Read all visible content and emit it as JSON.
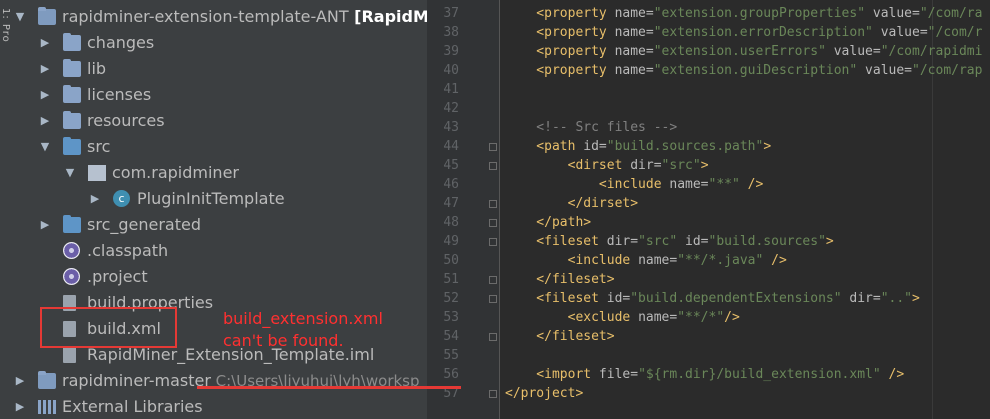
{
  "side_strip": {
    "text": "1: Pro"
  },
  "tree": [
    {
      "id": "root",
      "label": "rapidminer-extension-template-ANT",
      "suffix": "[RapidMi",
      "depth": 0,
      "arrow": "▼",
      "icon": "module-folder"
    },
    {
      "id": "changes",
      "label": "changes",
      "depth": 1,
      "arrow": "▶",
      "icon": "folder"
    },
    {
      "id": "lib",
      "label": "lib",
      "depth": 1,
      "arrow": "▶",
      "icon": "folder"
    },
    {
      "id": "licenses",
      "label": "licenses",
      "depth": 1,
      "arrow": "▶",
      "icon": "folder"
    },
    {
      "id": "resources",
      "label": "resources",
      "depth": 1,
      "arrow": "▶",
      "icon": "folder"
    },
    {
      "id": "src",
      "label": "src",
      "depth": 1,
      "arrow": "▼",
      "icon": "source-folder"
    },
    {
      "id": "com-rapidminer",
      "label": "com.rapidminer",
      "depth": 2,
      "arrow": "▼",
      "icon": "package"
    },
    {
      "id": "plugininittemplate",
      "label": "PluginInitTemplate",
      "depth": 3,
      "arrow": "▶",
      "icon": "class"
    },
    {
      "id": "src-generated",
      "label": "src_generated",
      "depth": 1,
      "arrow": "▶",
      "icon": "source-folder"
    },
    {
      "id": "classpath",
      "label": ".classpath",
      "depth": 1,
      "arrow": "",
      "icon": "eclipse-file"
    },
    {
      "id": "project",
      "label": ".project",
      "depth": 1,
      "arrow": "",
      "icon": "eclipse-file"
    },
    {
      "id": "build-properties",
      "label": "build.properties",
      "depth": 1,
      "arrow": "",
      "icon": "properties-file"
    },
    {
      "id": "build-xml",
      "label": "build.xml",
      "depth": 1,
      "arrow": "",
      "icon": "ant-file"
    },
    {
      "id": "iml",
      "label": "RapidMiner_Extension_Template.iml",
      "depth": 1,
      "arrow": "",
      "icon": "iml-file"
    },
    {
      "id": "rapidminer-master",
      "label": "rapidminer-master",
      "depth": 0,
      "arrow": "▶",
      "icon": "module-folder",
      "path": "C:\\Users\\liyuhui\\lyh\\worksp"
    },
    {
      "id": "external-libraries",
      "label": "External Libraries",
      "depth": 0,
      "arrow": "▶",
      "icon": "libraries"
    }
  ],
  "annotation": {
    "line1": "build_extension.xml",
    "line2": "can't be found.",
    "color": "#ff3030"
  },
  "editor": {
    "lines": [
      {
        "n": "37",
        "parts": [
          [
            "t",
            "    <property "
          ],
          [
            "a",
            "name="
          ],
          [
            "v",
            "\"extension.groupProperties\""
          ],
          [
            "a",
            " value="
          ],
          [
            "v",
            "\"/com/ra"
          ]
        ]
      },
      {
        "n": "38",
        "parts": [
          [
            "t",
            "    <property "
          ],
          [
            "a",
            "name="
          ],
          [
            "v",
            "\"extension.errorDescription\""
          ],
          [
            "a",
            " value="
          ],
          [
            "v",
            "\"/com/r"
          ]
        ]
      },
      {
        "n": "39",
        "parts": [
          [
            "t",
            "    <property "
          ],
          [
            "a",
            "name="
          ],
          [
            "v",
            "\"extension.userErrors\""
          ],
          [
            "a",
            " value="
          ],
          [
            "v",
            "\"/com/rapidmi"
          ]
        ]
      },
      {
        "n": "40",
        "parts": [
          [
            "t",
            "    <property "
          ],
          [
            "a",
            "name="
          ],
          [
            "v",
            "\"extension.guiDescription\""
          ],
          [
            "a",
            " value="
          ],
          [
            "v",
            "\"/com/rap"
          ]
        ]
      },
      {
        "n": "41",
        "parts": []
      },
      {
        "n": "42",
        "parts": []
      },
      {
        "n": "43",
        "parts": [
          [
            "c",
            "    <!-- Src files -->"
          ]
        ]
      },
      {
        "n": "44",
        "parts": [
          [
            "t",
            "    <path "
          ],
          [
            "a",
            "id="
          ],
          [
            "v",
            "\"build.sources.path\""
          ],
          [
            "t",
            ">"
          ]
        ]
      },
      {
        "n": "45",
        "parts": [
          [
            "t",
            "        <dirset "
          ],
          [
            "a",
            "dir="
          ],
          [
            "v",
            "\"src\""
          ],
          [
            "t",
            ">"
          ]
        ]
      },
      {
        "n": "46",
        "parts": [
          [
            "t",
            "            <include "
          ],
          [
            "a",
            "name="
          ],
          [
            "v",
            "\"**\""
          ],
          [
            "t",
            " />"
          ]
        ]
      },
      {
        "n": "47",
        "parts": [
          [
            "t",
            "        </dirset>"
          ]
        ]
      },
      {
        "n": "48",
        "parts": [
          [
            "t",
            "    </path>"
          ]
        ]
      },
      {
        "n": "49",
        "parts": [
          [
            "t",
            "    <fileset "
          ],
          [
            "a",
            "dir="
          ],
          [
            "v",
            "\"src\""
          ],
          [
            "a",
            " id="
          ],
          [
            "v",
            "\"build.sources\""
          ],
          [
            "t",
            ">"
          ]
        ]
      },
      {
        "n": "50",
        "parts": [
          [
            "t",
            "        <include "
          ],
          [
            "a",
            "name="
          ],
          [
            "v",
            "\"**/*.java\""
          ],
          [
            "t",
            " />"
          ]
        ]
      },
      {
        "n": "51",
        "parts": [
          [
            "t",
            "    </fileset>"
          ]
        ]
      },
      {
        "n": "52",
        "parts": [
          [
            "t",
            "    <fileset "
          ],
          [
            "a",
            "id="
          ],
          [
            "v",
            "\"build.dependentExtensions\""
          ],
          [
            "a",
            " dir="
          ],
          [
            "v",
            "\"..\""
          ],
          [
            "t",
            ">"
          ]
        ]
      },
      {
        "n": "53",
        "parts": [
          [
            "t",
            "        <exclude "
          ],
          [
            "a",
            "name="
          ],
          [
            "v",
            "\"**/*\""
          ],
          [
            "t",
            "/>"
          ]
        ]
      },
      {
        "n": "54",
        "parts": [
          [
            "t",
            "    </fileset>"
          ]
        ]
      },
      {
        "n": "55",
        "parts": []
      },
      {
        "n": "56",
        "parts": [
          [
            "t",
            "    <import "
          ],
          [
            "a",
            "file="
          ],
          [
            "v",
            "\"${rm.dir}/build_extension.xml\""
          ],
          [
            "t",
            " />"
          ]
        ]
      },
      {
        "n": "57",
        "parts": [
          [
            "t",
            "</project>"
          ]
        ]
      }
    ],
    "fold_lines": [
      "44",
      "45",
      "47",
      "48",
      "49",
      "51",
      "52",
      "54",
      "57"
    ]
  }
}
